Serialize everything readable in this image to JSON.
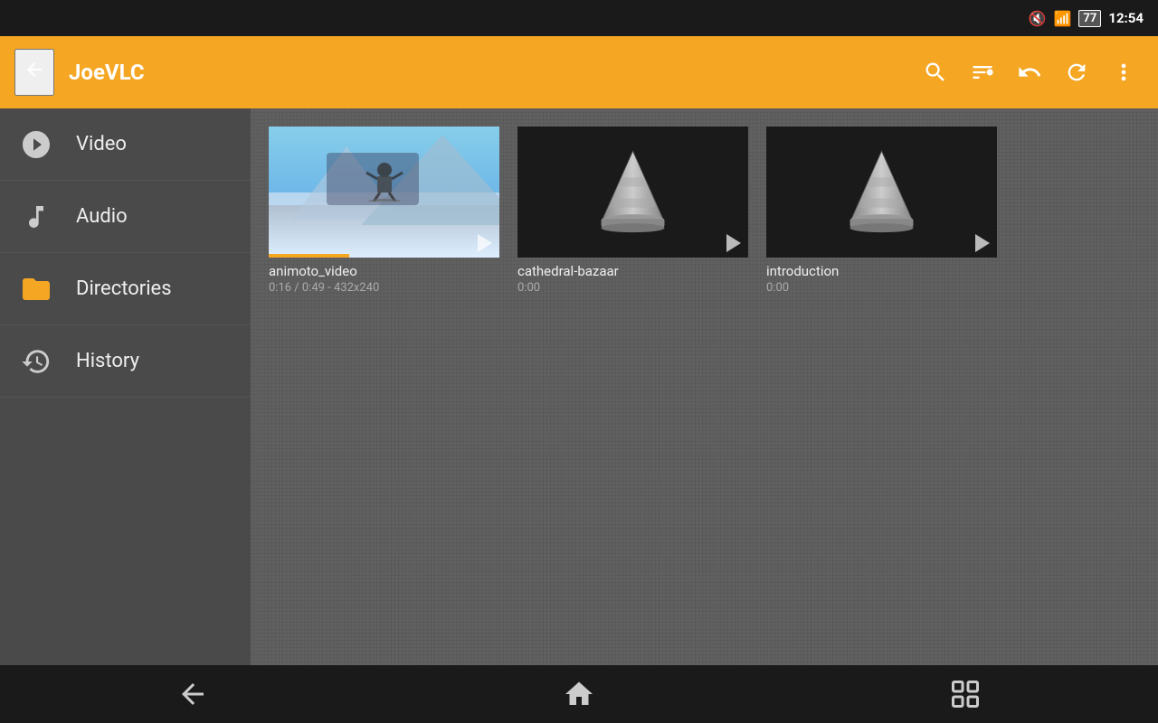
{
  "statusBar": {
    "time": "12:54",
    "batteryLevel": "77"
  },
  "toolbar": {
    "back_label": "‹",
    "title": "JoeVLC",
    "search_label": "🔍",
    "pin_label": "📌",
    "back_icon_label": "↩",
    "refresh_label": "↻",
    "more_label": "⋮"
  },
  "sidebar": {
    "items": [
      {
        "id": "video",
        "label": "Video",
        "icon": "video"
      },
      {
        "id": "audio",
        "label": "Audio",
        "icon": "audio"
      },
      {
        "id": "directories",
        "label": "Directories",
        "icon": "folder"
      },
      {
        "id": "history",
        "label": "History",
        "icon": "history"
      }
    ]
  },
  "content": {
    "videos": [
      {
        "id": "animoto_video",
        "title": "animoto_video",
        "meta": "0:16 / 0:49 - 432x240",
        "thumbnail": "snowboarder",
        "hasProgress": true
      },
      {
        "id": "cathedral-bazaar",
        "title": "cathedral-bazaar",
        "meta": "0:00",
        "thumbnail": "vlc-cone",
        "hasProgress": false
      },
      {
        "id": "introduction",
        "title": "introduction",
        "meta": "0:00",
        "thumbnail": "vlc-cone",
        "hasProgress": false
      }
    ]
  },
  "bottomNav": {
    "back_label": "↩",
    "home_label": "⌂",
    "recents_label": "▣"
  }
}
